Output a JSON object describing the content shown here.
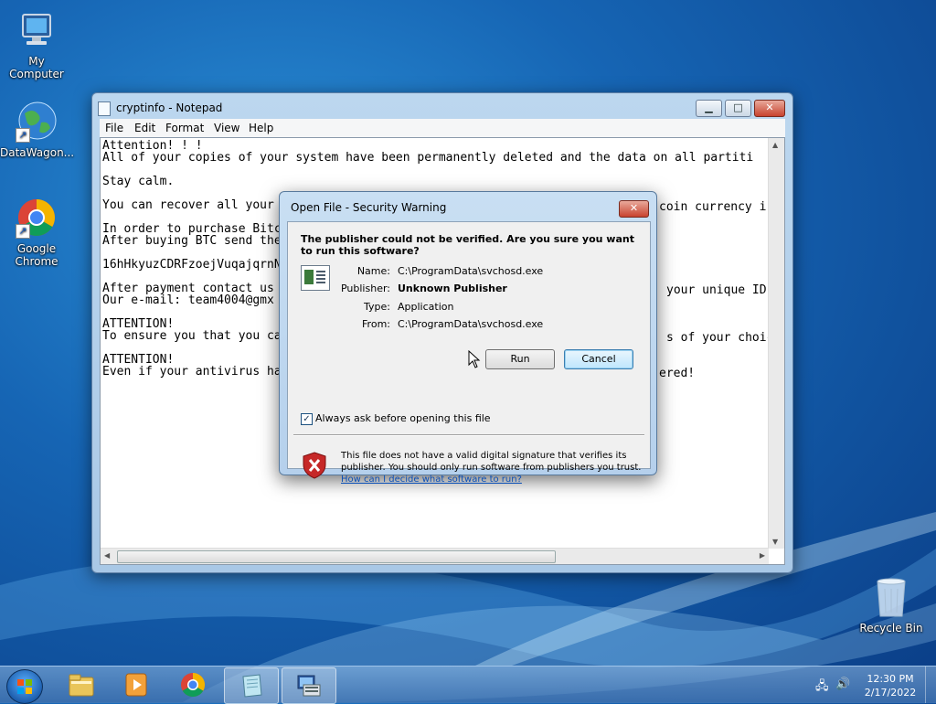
{
  "desktop": {
    "icons": [
      {
        "label": "My Computer",
        "icon": "computer-icon"
      },
      {
        "label": "DataWagon...",
        "icon": "globe-icon"
      },
      {
        "label": "Google Chrome",
        "icon": "chrome-icon"
      },
      {
        "label": "Recycle Bin",
        "icon": "recycle-bin-icon"
      }
    ]
  },
  "notepad": {
    "title": "cryptinfo - Notepad",
    "menu": [
      "File",
      "Edit",
      "Format",
      "View",
      "Help"
    ],
    "lines": [
      "Attention! ! !",
      "All of your copies of your system have been permanently deleted and the data on all partiti",
      "",
      "Stay calm.",
      "",
      "You can recover all your",
      "",
      "In order to purchase Bitc",
      "After buying BTC send the",
      "",
      "16hHkyuzCDRFzoejVuqajqrnN",
      "",
      "After payment contact us",
      "Our e-mail: team4004@gmx",
      "",
      "ATTENTION!",
      "To ensure you that you ca",
      "",
      "ATTENTION!",
      "Even if your antivirus ha"
    ],
    "right_fragments": [
      {
        "text": "coin currency i"
      },
      {
        "text": "your unique ID"
      },
      {
        "text": "s of your choic"
      },
      {
        "text": "ered!"
      }
    ]
  },
  "dialog": {
    "title": "Open File - Security Warning",
    "question": "The publisher could not be verified.  Are you sure you want to run this software?",
    "fields": {
      "name_label": "Name:",
      "name_value": "C:\\ProgramData\\svchosd.exe",
      "publisher_label": "Publisher:",
      "publisher_value": "Unknown Publisher",
      "type_label": "Type:",
      "type_value": "Application",
      "from_label": "From:",
      "from_value": "C:\\ProgramData\\svchosd.exe"
    },
    "run_label": "Run",
    "cancel_label": "Cancel",
    "checkbox_label": "Always ask before opening this file",
    "checkbox_checked": true,
    "warning_text": "This file does not have a valid digital signature that verifies its publisher.  You should only run software from publishers you trust.",
    "help_link": "How can I decide what software to run?"
  },
  "taskbar": {
    "time": "12:30 PM",
    "date": "2/17/2022"
  }
}
